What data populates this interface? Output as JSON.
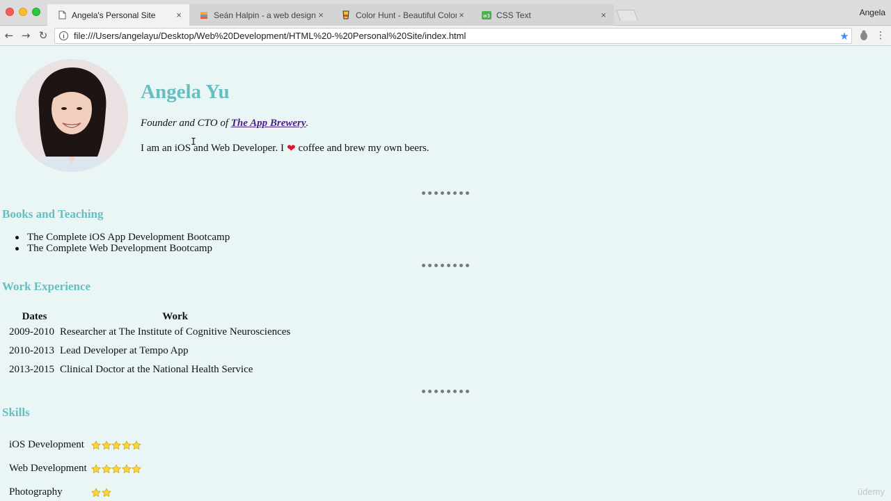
{
  "browser": {
    "tabs": [
      {
        "label": "Angela's Personal Site",
        "icon": "page-icon",
        "active": true
      },
      {
        "label": "Seán Halpin - a web designer & ",
        "icon": "halpin-favicon",
        "active": false
      },
      {
        "label": "Color Hunt - Beautiful Color Pa",
        "icon": "colorhunt-favicon",
        "active": false
      },
      {
        "label": "CSS Text",
        "icon": "w3schools-favicon",
        "active": false
      }
    ],
    "profile_name": "Angela",
    "url": "file:///Users/angelayu/Desktop/Web%20Development/HTML%20-%20Personal%20Site/index.html",
    "close_glyph": "×"
  },
  "page": {
    "name": "Angela Yu",
    "tagline_prefix": "Founder and CTO of ",
    "tagline_link": "The App Brewery",
    "tagline_suffix": ".",
    "intro_before": "I am an iOS and Web Developer. I",
    "intro_heart": "❤",
    "intro_after": "coffee and brew my own beers.",
    "books_title": "Books and Teaching",
    "books": [
      "The Complete iOS App Development Bootcamp",
      "The Complete Web Development Bootcamp"
    ],
    "work_title": "Work Experience",
    "work_headers": [
      "Dates",
      "Work"
    ],
    "work_rows": [
      [
        "2009-2010",
        "Researcher at The Institute of Cognitive Neurosciences"
      ],
      [
        "2010-2013",
        "Lead Developer at Tempo App"
      ],
      [
        "2013-2015",
        "Clinical Doctor at the National Health Service"
      ]
    ],
    "skills_title": "Skills",
    "skills": [
      {
        "name": "iOS Development",
        "stars": 5
      },
      {
        "name": "Web Development",
        "stars": 5
      },
      {
        "name": "Photography",
        "stars": 2
      }
    ]
  },
  "colors": {
    "heading": "#66bfbf",
    "background": "#eaf6f6",
    "link": "#4b1f85"
  },
  "watermark": "ūdemy"
}
